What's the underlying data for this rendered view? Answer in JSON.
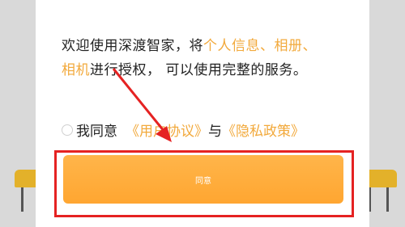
{
  "consent": {
    "line1_prefix": "欢迎使用深渡智家，将",
    "line1_highlight": "个人信息、相册、",
    "line2_highlight": "相机",
    "line2_rest": "进行授权， 可以使用完整的服务。"
  },
  "agreement": {
    "label": "我同意",
    "user_agreement": "《用户协议》",
    "connector": "与",
    "privacy_policy": "《隐私政策》"
  },
  "agree_button": {
    "label": "同意"
  },
  "colors": {
    "accent": "#f2a93b",
    "button": "#ffa631",
    "annotation": "#e52222"
  }
}
